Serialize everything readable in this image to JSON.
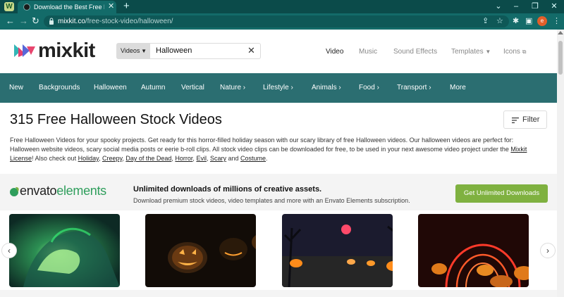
{
  "browser": {
    "app_mark": "W",
    "tab_title": "Download the Best Free Hallowe",
    "tab_close": "✕",
    "new_tab": "+",
    "url_domain": "mixkit.co",
    "url_path": "/free-stock-video/halloween/",
    "profile_initial": "e"
  },
  "header": {
    "logo_text": "mixkit",
    "search_type": "Videos",
    "search_value": "Halloween",
    "nav": {
      "video": "Video",
      "music": "Music",
      "sound_effects": "Sound Effects",
      "templates": "Templates",
      "icons": "Icons"
    }
  },
  "categories": [
    "New",
    "Backgrounds",
    "Halloween",
    "Autumn",
    "Vertical",
    "Nature",
    "Lifestyle",
    "Animals",
    "Food",
    "Transport",
    "More"
  ],
  "main": {
    "title": "315 Free Halloween Stock Videos",
    "filter_label": "Filter",
    "desc_line1": "Free Halloween Videos for your spooky projects. Get ready for this horror-filled holiday season with our scary library of free Halloween videos. Our halloween videos are perfect for:",
    "desc_line2": "Halloween website videos, scary social media posts or eerie b-roll clips. All stock video clips can be downloaded for free, to be used in your next awesome video project under the",
    "desc_mixkit": "Mixkit",
    "desc_license": "License",
    "desc_also": "! Also check out",
    "links": [
      "Holiday",
      "Creepy",
      "Day of the Dead",
      "Horror",
      "Evil",
      "Scary",
      "Costume"
    ],
    "sep": ", ",
    "and": " and ",
    "period": "."
  },
  "promo": {
    "brand_a": "envato",
    "brand_b": "elements",
    "headline": "Unlimited downloads of millions of creative assets.",
    "sub": "Download premium stock videos, video templates and more with an Envato Elements subscription.",
    "cta": "Get Unlimited Downloads"
  },
  "thumbnails": [
    "witch-hands-glowing",
    "jack-o-lantern-envato-watermark",
    "pumpkins-dark-forest-moon",
    "pumpkins-neon-arches"
  ],
  "colors": {
    "browser_dark": "#0b4b4a",
    "browser_tab": "#136b69",
    "category_bar": "#2b6e71",
    "cta_green": "#7fb140",
    "envato_green": "#2f9e5c"
  }
}
